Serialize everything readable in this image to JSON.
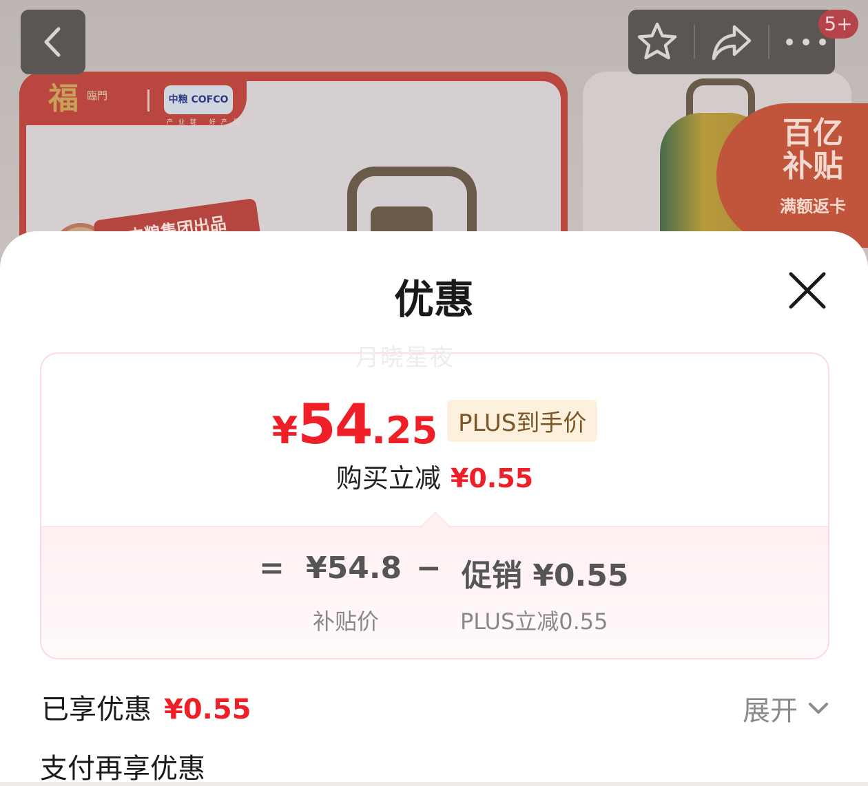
{
  "background": {
    "brand_fu": "福",
    "brand_fu_sub": "臨門",
    "cofco_logo": "中粮 COFCO",
    "cofco_sub": "产业链 好产品",
    "ribbon_text": "中粮集团出品",
    "subsidy_title": "百亿",
    "subsidy_title2": "补贴",
    "subsidy_sub": "满额返卡"
  },
  "nav": {
    "badge_count": "5+"
  },
  "sheet": {
    "title": "优惠",
    "watermark": "月晓星夜"
  },
  "price": {
    "symbol": "¥",
    "integer": "54",
    "decimal": ".25",
    "tag": "PLUS到手价",
    "reduce_label": "购买立减",
    "reduce_amount": "¥0.55"
  },
  "formula": {
    "equals": "=",
    "base_price": "¥54.8",
    "base_label": "补贴价",
    "minus": "−",
    "promo_price": "促销 ¥0.55",
    "promo_label": "PLUS立减0.55"
  },
  "enjoyed": {
    "label": "已享优惠",
    "amount": "¥0.55",
    "expand_label": "展开"
  },
  "pay": {
    "label": "支付再享优惠"
  },
  "colors": {
    "accent_red": "#ee1f26",
    "tag_bg": "#fdf0dd",
    "tag_text": "#7b5627"
  }
}
